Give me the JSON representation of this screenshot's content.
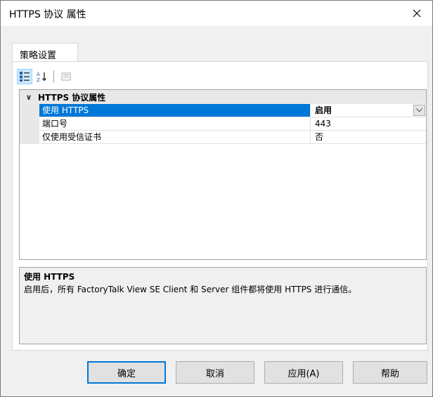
{
  "window": {
    "title": "HTTPS 协议 属性",
    "close_glyph": "✕"
  },
  "tabs": [
    {
      "label": "策略设置"
    }
  ],
  "toolbar": {
    "buttons": [
      {
        "icon": "categorized-icon",
        "active": true
      },
      {
        "icon": "sort-alphabetical-icon",
        "active": false
      },
      {
        "icon": "property-pages-icon",
        "active": false
      }
    ]
  },
  "grid": {
    "category": {
      "label": "HTTPS 协议属性",
      "chevron": "∨"
    },
    "rows": [
      {
        "name": "使用 HTTPS",
        "value": "启用",
        "selected": true,
        "has_dropdown": true
      },
      {
        "name": "端口号",
        "value": "443",
        "selected": false
      },
      {
        "name": "仅使用受信证书",
        "value": "否",
        "selected": false
      }
    ]
  },
  "description": {
    "title": "使用 HTTPS",
    "text": "启用后，所有 FactoryTalk View SE Client 和 Server 组件都将使用 HTTPS 进行通信。"
  },
  "buttons": {
    "ok": "确定",
    "cancel": "取消",
    "apply": "应用(A)",
    "help": "帮助"
  },
  "colors": {
    "selection": "#0078d7",
    "category_bg": "#e8e8e8",
    "dialog_bg": "#f0f0f0"
  }
}
